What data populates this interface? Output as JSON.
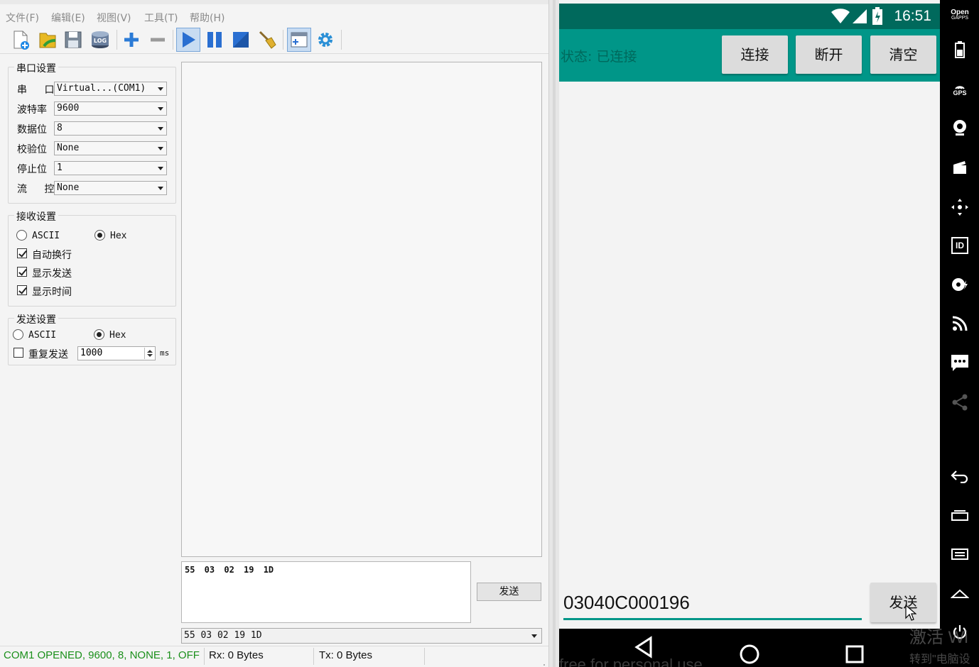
{
  "menu": {
    "file": "文件(F)",
    "edit": "编辑(E)",
    "view": "视图(V)",
    "tools": "工具(T)",
    "help": "帮助(H)"
  },
  "toolbar": {
    "icons": [
      "new-file-icon",
      "open-folder-icon",
      "save-icon",
      "log-icon",
      "add-icon",
      "remove-icon",
      "start-icon",
      "pause-icon",
      "stop-icon",
      "clear-broom-icon",
      "new-window-icon",
      "settings-gear-icon"
    ],
    "log_text": "LOG"
  },
  "serial_settings": {
    "title": "串口设置",
    "port_label": "串  口",
    "port_value": "Virtual...(COM1)",
    "baud_label": "波特率",
    "baud_value": "9600",
    "databits_label": "数据位",
    "databits_value": "8",
    "parity_label": "校验位",
    "parity_value": "None",
    "stopbits_label": "停止位",
    "stopbits_value": "1",
    "flow_label": "流  控",
    "flow_value": "None"
  },
  "receive_settings": {
    "title": "接收设置",
    "ascii_label": "ASCII",
    "hex_label": "Hex",
    "mode": "Hex",
    "auto_newline_label": "自动换行",
    "auto_newline": true,
    "show_send_label": "显示发送",
    "show_send": true,
    "show_time_label": "显示时间",
    "show_time": true
  },
  "send_settings": {
    "title": "发送设置",
    "ascii_label": "ASCII",
    "hex_label": "Hex",
    "mode": "Hex",
    "repeat_label": "重复发送",
    "repeat": false,
    "interval_value": "1000",
    "interval_unit": "ms"
  },
  "send_panel": {
    "text": "55 03 02 19 1D",
    "button_label": "发送",
    "history_value": "55 03 02 19 1D"
  },
  "statusbar": {
    "port_status": "COM1 OPENED, 9600, 8, NONE, 1, OFF",
    "rx": "Rx: 0 Bytes",
    "tx": "Tx: 0 Bytes",
    "port_status_color": "#1a8f1a"
  },
  "android": {
    "time": "16:51",
    "state_text": "状态: 已连接",
    "connect_label": "连接",
    "disconnect_label": "断开",
    "clear_label": "清空",
    "input_value": "03040C000196",
    "send_label": "发送",
    "watermark": "free for personal use",
    "accent_color": "#009688",
    "dark_color": "#00695c"
  },
  "side_panel": {
    "opengapps_line1": "Open",
    "opengapps_line2": "GAPPS",
    "gps_label": "GPS",
    "id_label": "ID"
  },
  "windows_watermark": {
    "line1": "激活 Wi",
    "line2": "转到\"电脑设"
  }
}
